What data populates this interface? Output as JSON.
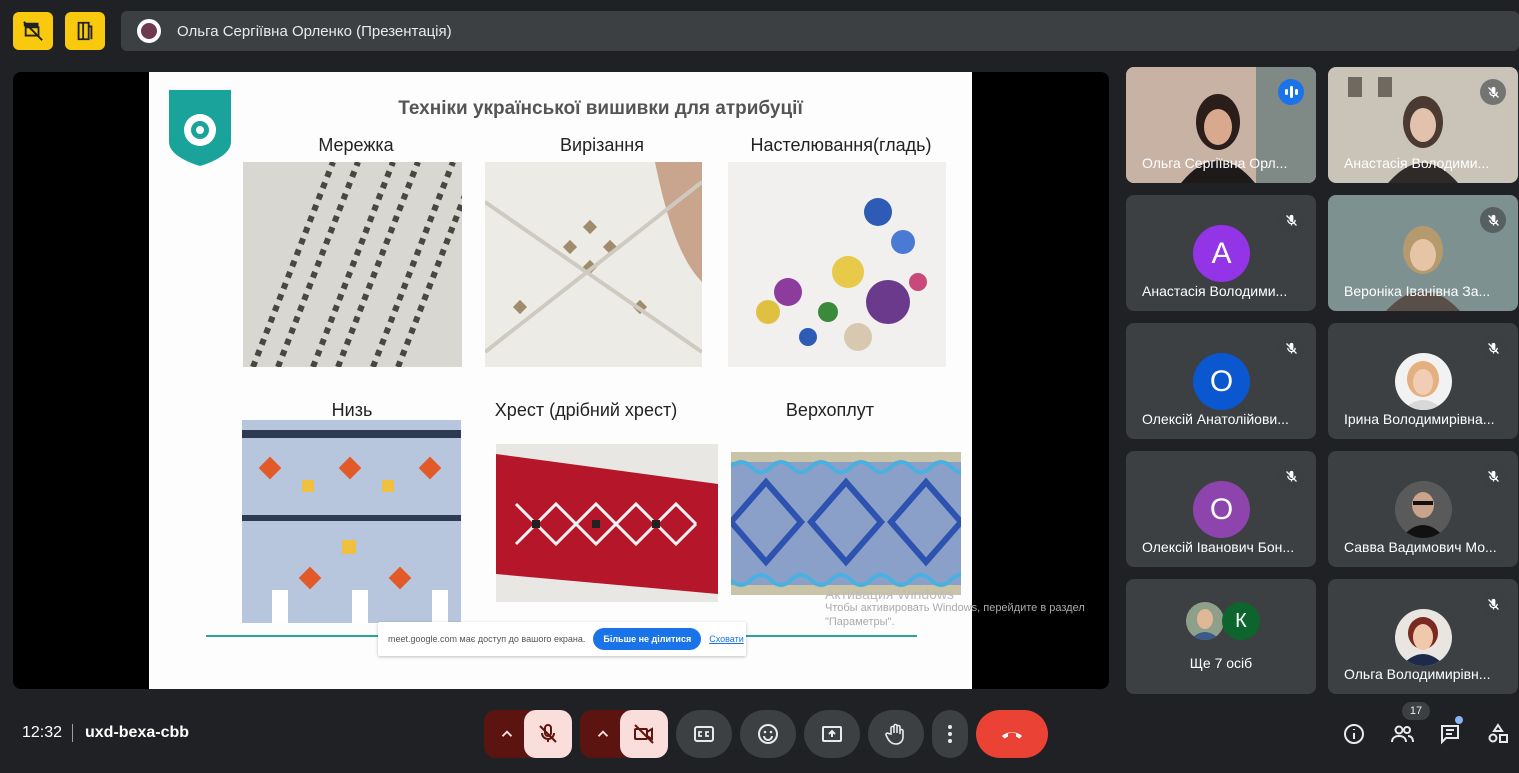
{
  "topbar": {
    "presenter_text": "Ольга Сергіївна Орленко (Презентація)"
  },
  "slide": {
    "title": "Техніки української вишивки для атрибуції",
    "techniques": [
      "Мережка",
      "Вирізання",
      "Настелювання(гладь)",
      "Низь",
      "Хрест (дрібний хрест)",
      "Верхоплут"
    ],
    "share_notice": "meet.google.com має доступ до вашого екрана.",
    "stop_sharing": "Більше не ділитися",
    "hide": "Сховати",
    "watermark_title": "Активация Windows",
    "watermark_text": "Чтобы активировать Windows, перейдите в раздел \"Параметры\"."
  },
  "participants": [
    {
      "name": "Ольга Сергіївна Орл...",
      "speaking": true
    },
    {
      "name": "Анастасія Володими...",
      "muted": true
    },
    {
      "name": "Анастасія Володими...",
      "initial": "А",
      "color": "#9334e6",
      "muted": true
    },
    {
      "name": "Вероніка Іванівна За...",
      "muted": true
    },
    {
      "name": "Олексій Анатолійови...",
      "initial": "О",
      "color": "#0b57d0",
      "muted": true
    },
    {
      "name": "Ірина Володимирівна...",
      "muted": true
    },
    {
      "name": "Олексій Іванович Бон...",
      "initial": "О",
      "color": "#8e44ad",
      "muted": true
    },
    {
      "name": "Савва Вадимович Мо...",
      "muted": true
    },
    {
      "name": "Ще 7 осіб",
      "initial": "К",
      "color": "#0d652d"
    },
    {
      "name": "Ольга Володимирівн...",
      "muted": true
    }
  ],
  "bottombar": {
    "time": "12:32",
    "meeting_code": "uxd-bexa-cbb",
    "participant_count": "17"
  },
  "colors": {
    "accent_yellow": "#f9c90e",
    "end_call": "#ea4335",
    "active_border": "#8ab4f8"
  }
}
